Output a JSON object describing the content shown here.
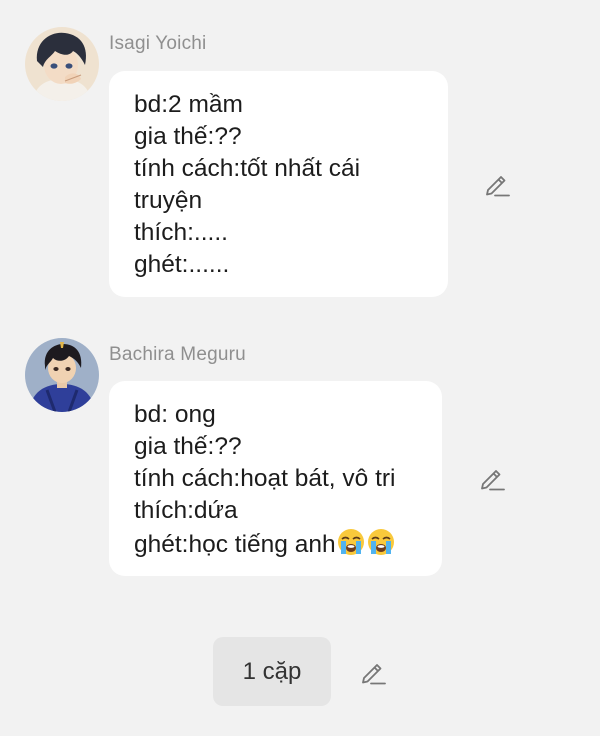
{
  "messages": [
    {
      "sender": "Isagi Yoichi",
      "avatar_icon": "dark-haired-character-avatar",
      "lines": [
        "bd:2 mầm",
        "gia thế:??",
        "tính cách:tốt nhất cái",
        "truyện",
        "thích:.....",
        "ghét:......"
      ],
      "edit_icon": "pencil-edit-icon"
    },
    {
      "sender": "Bachira Meguru",
      "avatar_icon": "blue-jersey-character-avatar",
      "lines": [
        "bd: ong",
        "gia thế:??",
        "tính cách:hoạt bát, vô tri",
        "thích:dứa",
        "ghét:học tiếng anh"
      ],
      "trailing_emoji": [
        "loudly-crying-face-emoji",
        "loudly-crying-face-emoji"
      ],
      "edit_icon": "pencil-edit-icon"
    }
  ],
  "choice": {
    "label": "1 cặp",
    "edit_icon": "pencil-edit-icon"
  },
  "colors": {
    "background": "#f2f2f2",
    "bubble": "#ffffff",
    "sender_name": "#8f8f8f",
    "message_text": "#1c1c1c",
    "chip": "#e5e5e5",
    "icon": "#777777"
  }
}
